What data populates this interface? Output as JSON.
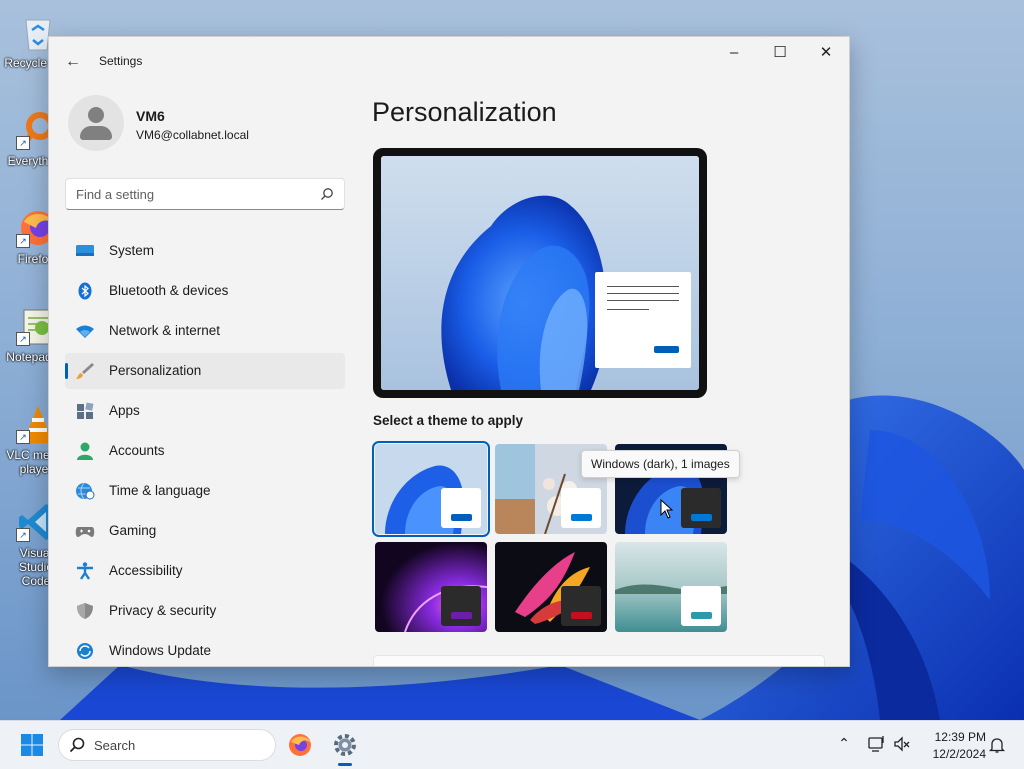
{
  "desktop": {
    "icons": [
      {
        "id": "recycle-bin",
        "label": "Recycle Bin"
      },
      {
        "id": "everything",
        "label": "Everything"
      },
      {
        "id": "firefox",
        "label": "Firefox"
      },
      {
        "id": "notepad",
        "label": "Notepad++"
      },
      {
        "id": "vlc",
        "label": "VLC media player"
      },
      {
        "id": "vscode",
        "label": "Visual Studio Code"
      }
    ]
  },
  "window": {
    "title": "Settings",
    "back_icon": "←",
    "minimize_icon": "–",
    "maximize_icon": "☐",
    "close_icon": "✕"
  },
  "user": {
    "name": "VM6",
    "email": "VM6@collabnet.local"
  },
  "search": {
    "placeholder": "Find a setting"
  },
  "nav": {
    "items": [
      {
        "label": "System",
        "icon": "monitor-icon"
      },
      {
        "label": "Bluetooth & devices",
        "icon": "bluetooth-icon"
      },
      {
        "label": "Network & internet",
        "icon": "wifi-icon"
      },
      {
        "label": "Personalization",
        "icon": "brush-icon",
        "selected": true
      },
      {
        "label": "Apps",
        "icon": "apps-icon"
      },
      {
        "label": "Accounts",
        "icon": "person-icon"
      },
      {
        "label": "Time & language",
        "icon": "globe-clock-icon"
      },
      {
        "label": "Gaming",
        "icon": "gamepad-icon"
      },
      {
        "label": "Accessibility",
        "icon": "accessibility-icon"
      },
      {
        "label": "Privacy & security",
        "icon": "shield-icon"
      },
      {
        "label": "Windows Update",
        "icon": "update-icon"
      }
    ]
  },
  "content": {
    "title": "Personalization",
    "theme_heading": "Select a theme to apply",
    "tooltip": "Windows (dark), 1 images",
    "themes": [
      {
        "name": "windows-light",
        "selected": true,
        "accent": "#005fb8"
      },
      {
        "name": "windows-spotlight",
        "accent": "#0078d4"
      },
      {
        "name": "windows-dark",
        "accent": "#0078d4"
      },
      {
        "name": "glow",
        "accent": "#6b1fa8"
      },
      {
        "name": "captured-motion",
        "accent": "#c50f1f"
      },
      {
        "name": "flow",
        "accent": "#2e9aa8"
      }
    ]
  },
  "taskbar": {
    "search_label": "Search",
    "time": "12:39 PM",
    "date": "12/2/2024"
  },
  "colors": {
    "accent": "#005fb8",
    "window_bg": "#f3f3f3",
    "selected_nav_bg": "#e9e9e9"
  }
}
